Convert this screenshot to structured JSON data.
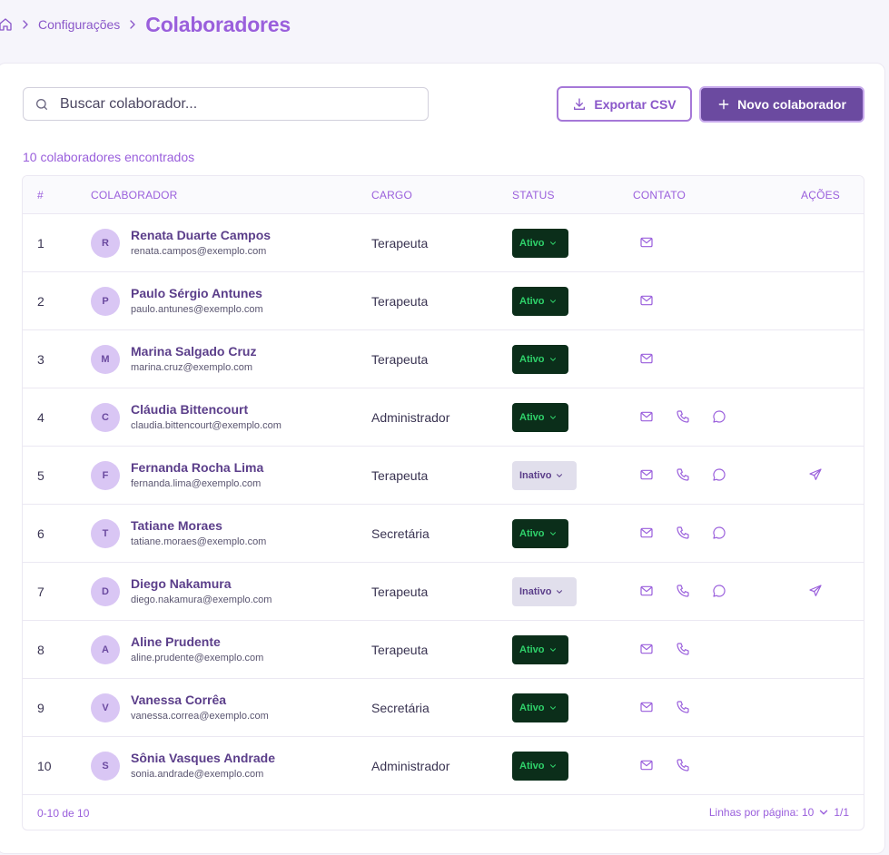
{
  "breadcrumb": {
    "section": "Configurações",
    "current": "Colaboradores"
  },
  "toolbar": {
    "search_placeholder": "Buscar colaborador...",
    "export_label": "Exportar CSV",
    "new_label": "Novo colaborador"
  },
  "results": {
    "count_label": "10 colaboradores encontrados"
  },
  "table": {
    "headers": {
      "num": "#",
      "collaborator": "COLABORADOR",
      "role": "CARGO",
      "status": "STATUS",
      "contact": "CONTATO",
      "actions": "AÇÕES"
    },
    "rows": [
      {
        "num": "1",
        "initial": "R",
        "name": "Renata Duarte Campos",
        "email": "renata.campos@exemplo.com",
        "role": "Terapeuta",
        "status": "Ativo",
        "phone": false,
        "chat": false,
        "send": false
      },
      {
        "num": "2",
        "initial": "P",
        "name": "Paulo Sérgio Antunes",
        "email": "paulo.antunes@exemplo.com",
        "role": "Terapeuta",
        "status": "Ativo",
        "phone": false,
        "chat": false,
        "send": false
      },
      {
        "num": "3",
        "initial": "M",
        "name": "Marina Salgado Cruz",
        "email": "marina.cruz@exemplo.com",
        "role": "Terapeuta",
        "status": "Ativo",
        "phone": false,
        "chat": false,
        "send": false
      },
      {
        "num": "4",
        "initial": "C",
        "name": "Cláudia Bittencourt",
        "email": "claudia.bittencourt@exemplo.com",
        "role": "Administrador",
        "status": "Ativo",
        "phone": true,
        "chat": true,
        "send": false
      },
      {
        "num": "5",
        "initial": "F",
        "name": "Fernanda Rocha Lima",
        "email": "fernanda.lima@exemplo.com",
        "role": "Terapeuta",
        "status": "Inativo",
        "phone": true,
        "chat": true,
        "send": true
      },
      {
        "num": "6",
        "initial": "T",
        "name": "Tatiane Moraes",
        "email": "tatiane.moraes@exemplo.com",
        "role": "Secretária",
        "status": "Ativo",
        "phone": true,
        "chat": true,
        "send": false
      },
      {
        "num": "7",
        "initial": "D",
        "name": "Diego Nakamura",
        "email": "diego.nakamura@exemplo.com",
        "role": "Terapeuta",
        "status": "Inativo",
        "phone": true,
        "chat": true,
        "send": true
      },
      {
        "num": "8",
        "initial": "A",
        "name": "Aline Prudente",
        "email": "aline.prudente@exemplo.com",
        "role": "Terapeuta",
        "status": "Ativo",
        "phone": true,
        "chat": false,
        "send": false
      },
      {
        "num": "9",
        "initial": "V",
        "name": "Vanessa Corrêa",
        "email": "vanessa.correa@exemplo.com",
        "role": "Secretária",
        "status": "Ativo",
        "phone": true,
        "chat": false,
        "send": false
      },
      {
        "num": "10",
        "initial": "S",
        "name": "Sônia Vasques Andrade",
        "email": "sonia.andrade@exemplo.com",
        "role": "Administrador",
        "status": "Ativo",
        "phone": true,
        "chat": false,
        "send": false
      }
    ]
  },
  "pagination": {
    "range": "0-10 de 10",
    "rows_per_page_label": "Linhas por página: 10",
    "page": "1/1"
  },
  "icons": {
    "home": "home-icon",
    "separator": "chevron-right-icon",
    "search": "search-icon",
    "export": "download-icon",
    "new": "plus-icon",
    "email": "mail-icon",
    "phone": "phone-icon",
    "chat": "chat-bubble-icon",
    "send": "send-icon",
    "dropdown": "chevron-down-icon"
  },
  "colors": {
    "accent": "#9a5fdc",
    "primary_button": "#6b4aa0",
    "active_bg": "#0b2e1a",
    "active_text": "#2fd36b",
    "inactive_bg": "#e1dfec"
  }
}
